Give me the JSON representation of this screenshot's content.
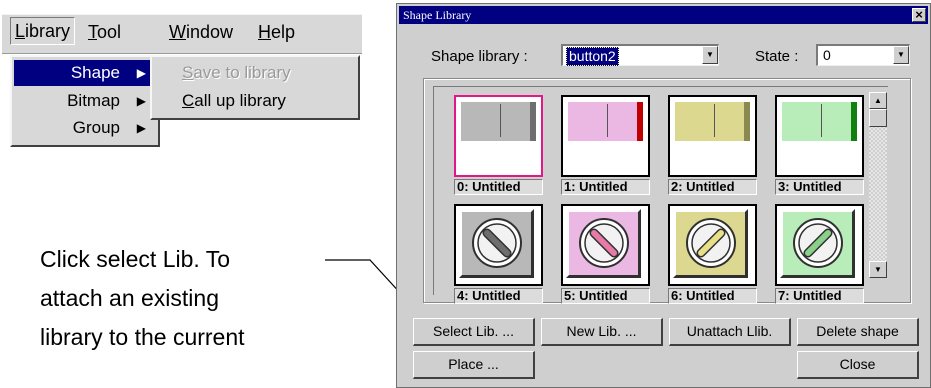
{
  "menubar": {
    "items": [
      {
        "label": "Library",
        "key": "L",
        "rest": "ibrary"
      },
      {
        "label": "Tool",
        "key": "T",
        "rest": "ool"
      },
      {
        "label": "Window",
        "key": "W",
        "rest": "indow"
      },
      {
        "label": "Help",
        "key": "H",
        "rest": "elp"
      }
    ]
  },
  "library_menu": {
    "items": [
      {
        "label": "Shape"
      },
      {
        "label": "Bitmap"
      },
      {
        "label": "Group"
      }
    ]
  },
  "shape_submenu": {
    "items": [
      {
        "label": "Save to library",
        "key": "S",
        "rest": "ave to library",
        "enabled": false
      },
      {
        "label": "Call up library",
        "key": "C",
        "rest": "all up library",
        "enabled": true
      }
    ]
  },
  "caption": {
    "lines": [
      "Click select Lib. To",
      "attach an existing",
      "library to the current"
    ]
  },
  "dialog": {
    "title": "Shape Library",
    "shape_library_label": "Shape library :",
    "shape_library_value": "button2",
    "state_label": "State :",
    "state_value": "0",
    "tiles": [
      {
        "label": "0: Untitled",
        "color": "#b8b8b8",
        "shade": "#6e6e6e",
        "kind": "rect",
        "selected": true
      },
      {
        "label": "1: Untitled",
        "color": "#eab8e2",
        "shade": "#c00000",
        "kind": "rect",
        "selected": false
      },
      {
        "label": "2: Untitled",
        "color": "#dcd890",
        "shade": "#8a8a50",
        "kind": "rect",
        "selected": false
      },
      {
        "label": "3: Untitled",
        "color": "#b8ecb8",
        "shade": "#108010",
        "kind": "rect",
        "selected": false
      },
      {
        "label": "4: Untitled",
        "color": "#b8b8b8",
        "needle": "#6e6e6e",
        "kind": "round",
        "selected": false
      },
      {
        "label": "5: Untitled",
        "color": "#eab8e2",
        "needle": "#e87aa8",
        "kind": "round",
        "selected": false
      },
      {
        "label": "6: Untitled",
        "color": "#dcd890",
        "needle": "#e8e088",
        "kind": "round",
        "selected": false
      },
      {
        "label": "7: Untitled",
        "color": "#b8ecb8",
        "needle": "#8ad08a",
        "kind": "round",
        "selected": false
      }
    ],
    "buttons": {
      "select_lib": "Select Lib. ...",
      "new_lib": "New Lib. ...",
      "unattach_lib": "Unattach Llib.",
      "delete_shape": "Delete shape",
      "place": "Place ...",
      "close": "Close"
    }
  }
}
